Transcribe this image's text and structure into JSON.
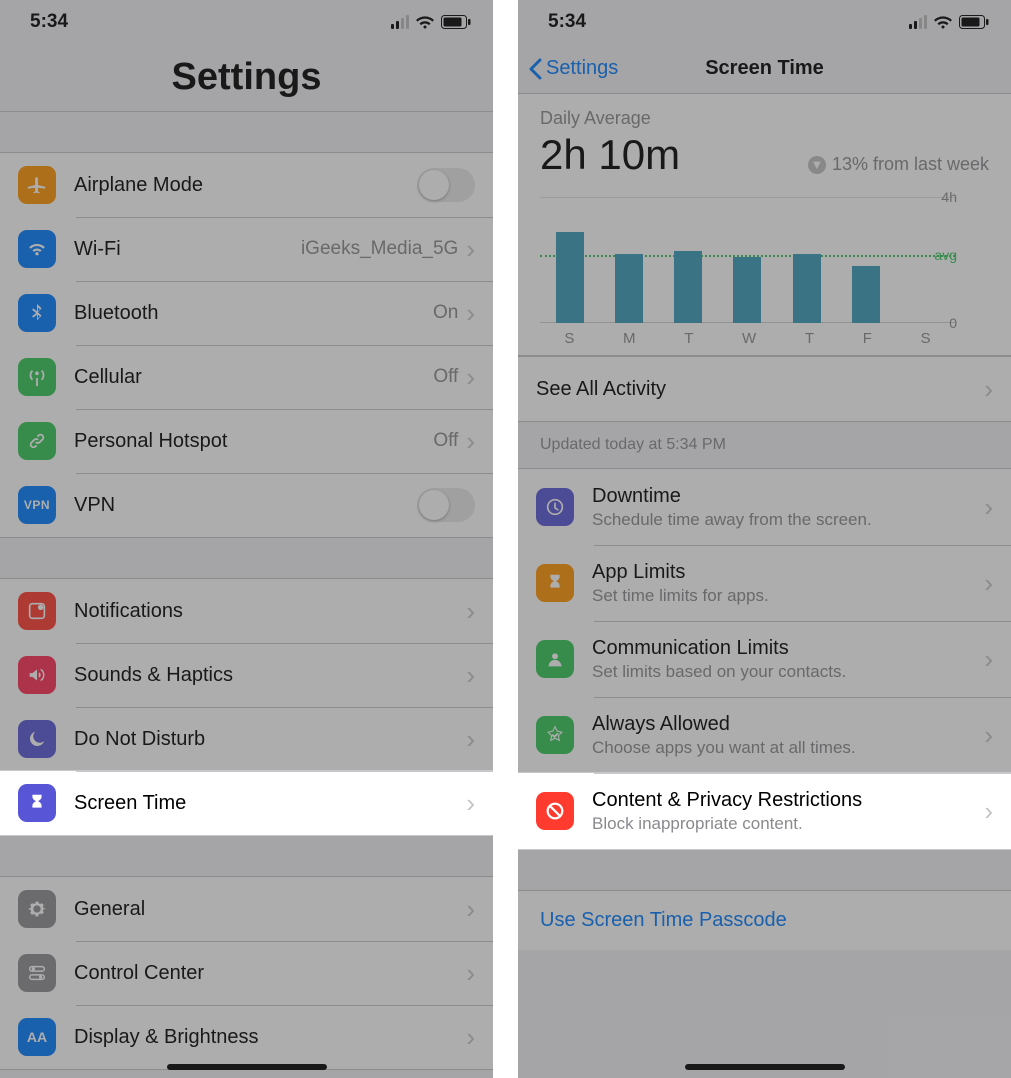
{
  "status": {
    "time": "5:34"
  },
  "left": {
    "title": "Settings",
    "group1": [
      {
        "id": "airplane",
        "label": "Airplane Mode",
        "type": "toggle",
        "icon": "airplane",
        "color": "#ff9500"
      },
      {
        "id": "wifi",
        "label": "Wi-Fi",
        "value": "iGeeks_Media_5G",
        "type": "nav",
        "icon": "wifi",
        "color": "#007aff"
      },
      {
        "id": "bluetooth",
        "label": "Bluetooth",
        "value": "On",
        "type": "nav",
        "icon": "bluetooth",
        "color": "#007aff"
      },
      {
        "id": "cellular",
        "label": "Cellular",
        "value": "Off",
        "type": "nav",
        "icon": "antenna",
        "color": "#34c759"
      },
      {
        "id": "hotspot",
        "label": "Personal Hotspot",
        "value": "Off",
        "type": "nav",
        "icon": "link",
        "color": "#34c759"
      },
      {
        "id": "vpn",
        "label": "VPN",
        "type": "toggle",
        "icon": "vpn",
        "color": "#007aff"
      }
    ],
    "group2": [
      {
        "id": "notifications",
        "label": "Notifications",
        "icon": "bell",
        "color": "#ff3b30"
      },
      {
        "id": "sounds",
        "label": "Sounds & Haptics",
        "icon": "speaker",
        "color": "#ff2d55"
      },
      {
        "id": "dnd",
        "label": "Do Not Disturb",
        "icon": "moon",
        "color": "#5856d6"
      },
      {
        "id": "screentime",
        "label": "Screen Time",
        "icon": "hourglass",
        "color": "#5856d6",
        "highlight": true
      }
    ],
    "group3": [
      {
        "id": "general",
        "label": "General",
        "icon": "gear",
        "color": "#8e8e93"
      },
      {
        "id": "controlcenter",
        "label": "Control Center",
        "icon": "switches",
        "color": "#8e8e93"
      },
      {
        "id": "display",
        "label": "Display & Brightness",
        "icon": "aa",
        "color": "#007aff"
      }
    ]
  },
  "right": {
    "back": "Settings",
    "title": "Screen Time",
    "daily_label": "Daily Average",
    "daily_value": "2h 10m",
    "trend_text": "13% from last week",
    "see_all": "See All Activity",
    "updated": "Updated today at 5:34 PM",
    "options": [
      {
        "id": "downtime",
        "title": "Downtime",
        "sub": "Schedule time away from the screen.",
        "icon": "clock",
        "color": "#5856d6"
      },
      {
        "id": "applimits",
        "title": "App Limits",
        "sub": "Set time limits for apps.",
        "icon": "hourglass",
        "color": "#ff9500"
      },
      {
        "id": "commlimits",
        "title": "Communication Limits",
        "sub": "Set limits based on your contacts.",
        "icon": "person",
        "color": "#34c759"
      },
      {
        "id": "always",
        "title": "Always Allowed",
        "sub": "Choose apps you want at all times.",
        "icon": "check",
        "color": "#34c759"
      },
      {
        "id": "content",
        "title": "Content & Privacy Restrictions",
        "sub": "Block inappropriate content.",
        "icon": "nosign",
        "color": "#ff3b30",
        "highlight": true
      }
    ],
    "passcode": "Use Screen Time Passcode"
  },
  "chart_data": {
    "type": "bar",
    "categories": [
      "S",
      "M",
      "T",
      "W",
      "T",
      "F",
      "S"
    ],
    "values_hours": [
      2.9,
      2.2,
      2.3,
      2.1,
      2.2,
      1.8,
      0
    ],
    "avg_hours": 2.17,
    "ylim": [
      0,
      4
    ],
    "ylabel_top": "4h",
    "ylabel_bottom": "0",
    "ylabel_avg": "avg",
    "title": "Daily Average",
    "xlabel": "",
    "ylabel": ""
  }
}
